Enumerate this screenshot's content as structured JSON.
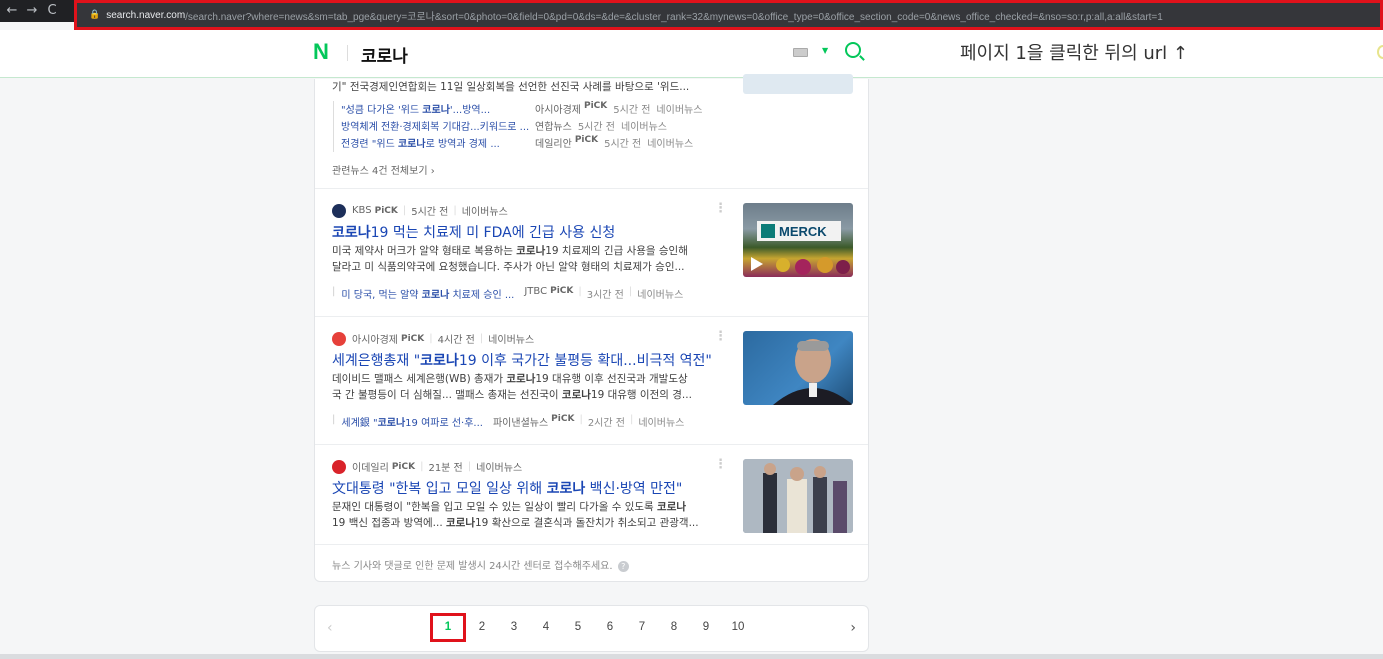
{
  "browser": {
    "back": "←",
    "forward": "→",
    "reload": "C",
    "url_domain": "search.naver.com",
    "url_rest": "/search.naver?where=news&sm=tab_pge&query=코로나&sort=0&photo=0&field=0&pd=0&ds=&de=&cluster_rank=32&mynews=0&office_type=0&office_section_code=0&news_office_checked=&nso=so:r,p:all,a:all&start=1"
  },
  "header": {
    "logo": "N",
    "query": "코로나",
    "annotation": "페이지 1을 클릭한 뒤의 url ↑"
  },
  "news": {
    "top_item": {
      "desc": "기\" 전국경제인연합회는 11일 일상회복을 선언한 선진국 사례를 바탕으로 '위드...",
      "related": [
        {
          "title": "\"성큼 다가온 '위드 코로나'...방역...",
          "press": "아시아경제",
          "pick": "PiCK",
          "time": "5시간 전",
          "source": "네이버뉴스"
        },
        {
          "title": "방역체계 전환·경제회복 기대감...키워드로 ...",
          "press": "연합뉴스",
          "pick": "",
          "time": "5시간 전",
          "source": "네이버뉴스"
        },
        {
          "title": "전경련 \"위드 코로나로 방역과 경제 ...",
          "press": "데일리안",
          "pick": "PiCK",
          "time": "5시간 전",
          "source": "네이버뉴스"
        }
      ],
      "related_all": "관련뉴스 4건 전체보기 ›"
    },
    "items": [
      {
        "press": "KBS",
        "pick": "PiCK",
        "time": "5시간 전",
        "source": "네이버뉴스",
        "title": "코로나19 먹는 치료제 미 FDA에 긴급 사용 신청",
        "desc1": "미국 제약사 머크가 알약 형태로 복용하는 코로나19 치료제의 긴급 사용을 승인해",
        "desc2": "달라고 미 식품의약국에 요청했습니다. 주사가 아닌 알약 형태의 치료제가 승인...",
        "related_title": "미 당국, 먹는 알약 코로나 치료제 승인 ...",
        "related_press": "JTBC",
        "related_pick": "PiCK",
        "related_time": "3시간 전",
        "related_source": "네이버뉴스",
        "thumb_text": "MERCK"
      },
      {
        "press": "아시아경제",
        "pick": "PiCK",
        "time": "4시간 전",
        "source": "네이버뉴스",
        "title": "세계은행총재 \"코로나19 이후 국가간 불평등 확대...비극적 역전\"",
        "desc1": "데이비드 맬패스 세계은행(WB) 총재가 코로나19 대유행 이후 선진국과 개발도상",
        "desc2": "국 간 불평등이 더 심해질... 맬패스 총재는 선진국이 코로나19 대유행 이전의 경...",
        "related_title": "세계銀 \"코로나19 여파로 선·후...",
        "related_press": "파이낸셜뉴스",
        "related_pick": "PiCK",
        "related_time": "2시간 전",
        "related_source": "네이버뉴스"
      },
      {
        "press": "이데일리",
        "pick": "PiCK",
        "time": "21분 전",
        "source": "네이버뉴스",
        "title": "文대통령 \"한복 입고 모일 일상 위해 코로나 백신·방역 만전\"",
        "desc1": "문재인 대통령이 \"한복을 입고 모일 수 있는 일상이 빨리 다가올 수 있도록 코로나",
        "desc2": "19 백신 접종과 방역에... 코로나19 확산으로 결혼식과 돌잔치가 취소되고 관광객..."
      }
    ],
    "footer": "뉴스 기사와 댓글로 인한 문제 발생시 24시간 센터로 접수해주세요."
  },
  "pagination": {
    "prev": "‹",
    "next": "›",
    "pages": [
      "1",
      "2",
      "3",
      "4",
      "5",
      "6",
      "7",
      "8",
      "9",
      "10"
    ]
  },
  "colors": {
    "naver_green": "#03c75a",
    "highlight_red": "#e0121b",
    "link_blue": "#1a46b4"
  }
}
